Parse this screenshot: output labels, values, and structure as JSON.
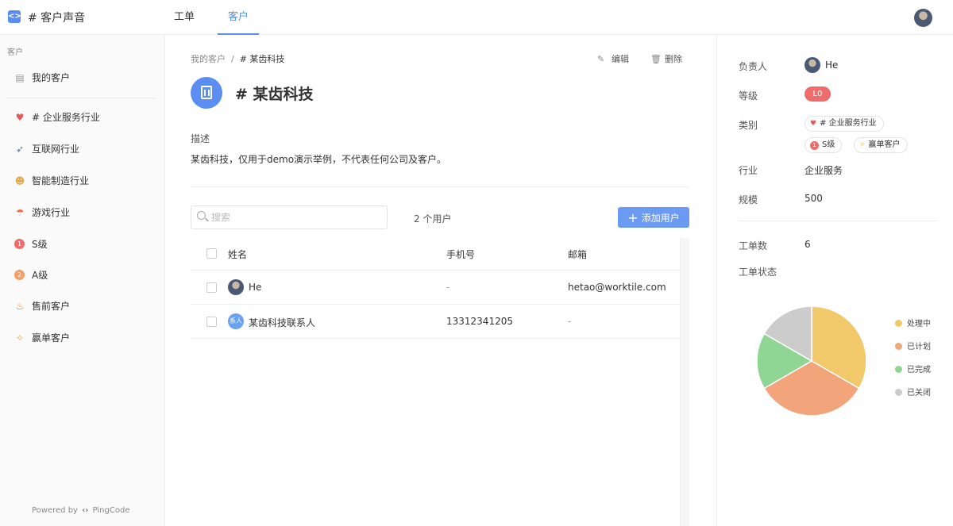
{
  "header": {
    "app_title": "# 客户声音",
    "tabs": [
      {
        "label": "工单"
      },
      {
        "label": "客户"
      }
    ],
    "active_tab": "客户"
  },
  "sidebar": {
    "section_label": "客户",
    "my_customers": "我的客户",
    "items": [
      {
        "label": "# 企业服务行业",
        "icon": "heart-icon"
      },
      {
        "label": "互联网行业",
        "icon": "rocket-icon"
      },
      {
        "label": "智能制造行业",
        "icon": "worker-icon"
      },
      {
        "label": "游戏行业",
        "icon": "island-icon"
      },
      {
        "label": "S级",
        "icon": "number-1-icon",
        "badge": "1",
        "color": "#ef6c6c"
      },
      {
        "label": "A级",
        "icon": "number-2-icon",
        "badge": "2",
        "color": "#f2a06b"
      },
      {
        "label": "售前客户",
        "icon": "fire-icon"
      },
      {
        "label": "赢单客户",
        "icon": "party-popper-icon"
      }
    ],
    "powered_prefix": "Powered by",
    "powered_brand": "PingCode"
  },
  "main": {
    "breadcrumb": {
      "parent": "我的客户",
      "separator": "/",
      "current": "# 某齿科技"
    },
    "actions": {
      "edit": "编辑",
      "delete": "删除"
    },
    "title": "# 某齿科技",
    "description_label": "描述",
    "description": "某齿科技，仅用于demo演示举例，不代表任何公司及客户。",
    "search_placeholder": "搜索",
    "user_count": "2 个用户",
    "add_user": "添加用户",
    "table": {
      "headers": {
        "name": "姓名",
        "phone": "手机号",
        "email": "邮箱"
      },
      "rows": [
        {
          "name": "He",
          "phone": "-",
          "email": "hetao@worktile.com",
          "avatar": "photo"
        },
        {
          "name": "某齿科技联系人",
          "phone": "13312341205",
          "email": "-",
          "avatar": "text",
          "avatar_text": "系人"
        }
      ]
    }
  },
  "details": {
    "owner_label": "负责人",
    "owner": "He",
    "level_label": "等级",
    "level": "L0",
    "level_color": "#ef6c6c",
    "category_label": "类别",
    "categories": [
      {
        "label": "# 企业服务行业",
        "icon": "heart-icon"
      },
      {
        "label": "S级",
        "icon": "number-1-icon",
        "badge": "1"
      },
      {
        "label": "赢单客户",
        "icon": "party-popper-icon"
      }
    ],
    "industry_label": "行业",
    "industry": "企业服务",
    "scale_label": "规模",
    "scale": "500",
    "ticket_count_label": "工单数",
    "ticket_count": "6",
    "ticket_status_label": "工单状态"
  },
  "chart_data": {
    "type": "pie",
    "categories": [
      "处理中",
      "已计划",
      "已完成",
      "已关闭"
    ],
    "values": [
      2,
      2,
      1,
      1
    ],
    "colors": [
      "#f2c96a",
      "#f2a47a",
      "#8fd694",
      "#cccccc"
    ],
    "legend": "right"
  }
}
